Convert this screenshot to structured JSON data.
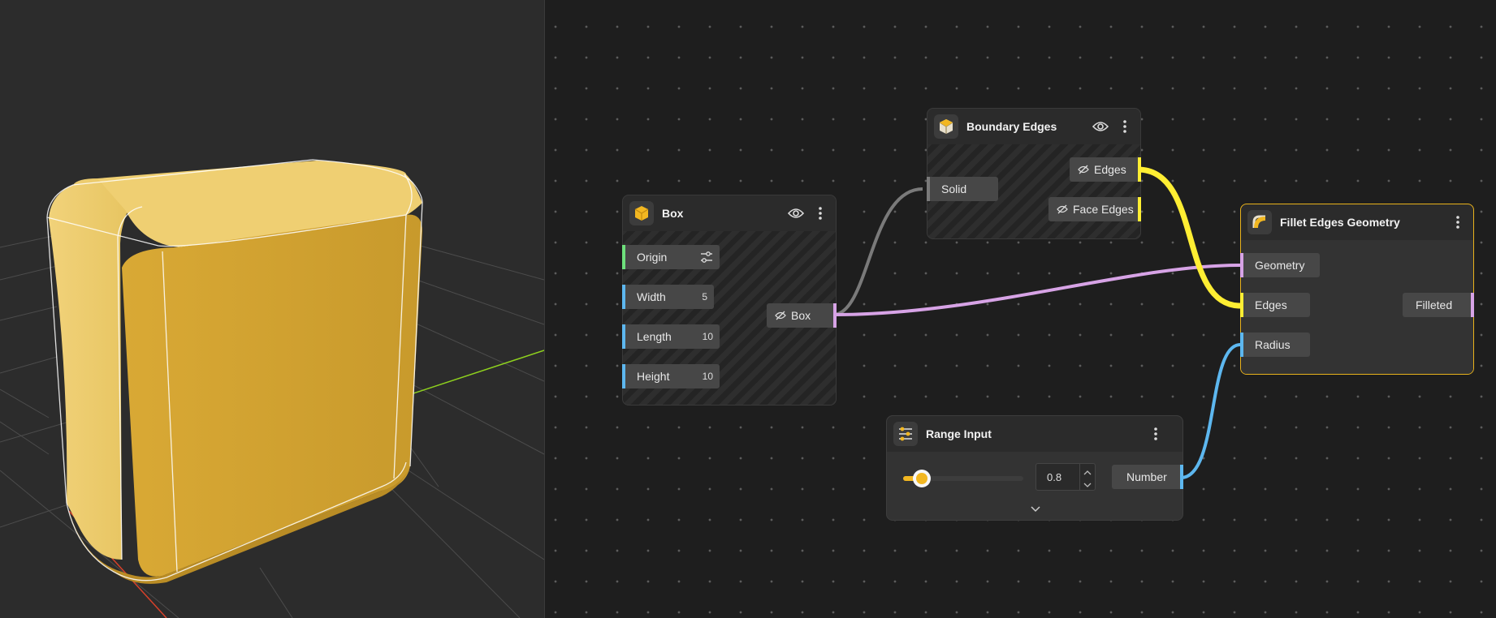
{
  "nodes": {
    "box": {
      "title": "Box",
      "inputs": [
        {
          "label": "Origin",
          "value": ""
        },
        {
          "label": "Width",
          "value": "5"
        },
        {
          "label": "Length",
          "value": "10"
        },
        {
          "label": "Height",
          "value": "10"
        }
      ],
      "output": "Box"
    },
    "boundary": {
      "title": "Boundary Edges",
      "input": "Solid",
      "outputs": [
        "Edges",
        "Face Edges"
      ]
    },
    "fillet": {
      "title": "Fillet Edges Geometry",
      "inputs": [
        "Geometry",
        "Edges",
        "Radius"
      ],
      "output": "Filleted"
    },
    "range": {
      "title": "Range Input",
      "value": "0.8",
      "slider_fraction": 0.08,
      "output": "Number"
    }
  },
  "colors": {
    "accent": "#e8b21c",
    "geometry_wire": "#d7a3e6",
    "edges_wire": "#ffee33",
    "number_wire": "#5db7ef",
    "vector_socket": "#6ee07c",
    "solid_wire": "#7a7a7a"
  },
  "icons": {
    "box": "cube-icon",
    "boundary": "cube-outline-icon",
    "fillet": "fillet-icon",
    "range": "sliders-icon",
    "visibility": "eye-icon",
    "hidden": "eye-off-icon",
    "menu": "vertical-dots-icon",
    "expand": "chevron-down-icon"
  }
}
